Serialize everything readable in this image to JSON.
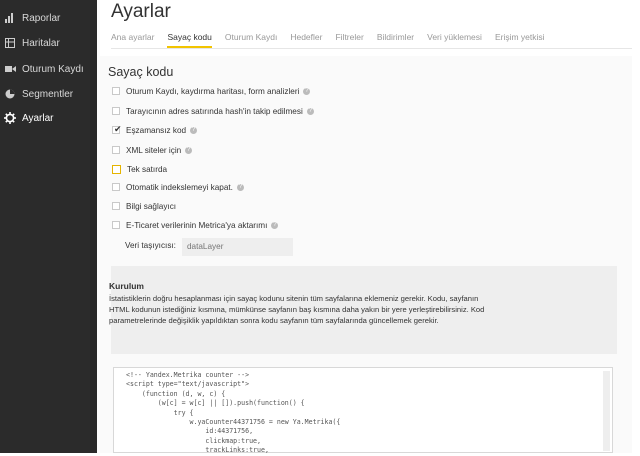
{
  "sidebar": {
    "items": [
      {
        "label": "Raporlar",
        "icon": "bar-chart-icon"
      },
      {
        "label": "Haritalar",
        "icon": "map-icon"
      },
      {
        "label": "Oturum Kaydı",
        "icon": "video-icon"
      },
      {
        "label": "Segmentler",
        "icon": "segment-icon"
      },
      {
        "label": "Ayarlar",
        "icon": "gear-icon",
        "active": true
      }
    ]
  },
  "page": {
    "title": "Ayarlar"
  },
  "tabs": [
    {
      "label": "Ana ayarlar"
    },
    {
      "label": "Sayaç kodu",
      "active": true
    },
    {
      "label": "Oturum Kaydı"
    },
    {
      "label": "Hedefler"
    },
    {
      "label": "Filtreler"
    },
    {
      "label": "Bildirimler"
    },
    {
      "label": "Veri yüklemesi"
    },
    {
      "label": "Erişim yetkisi"
    }
  ],
  "section": {
    "title": "Sayaç kodu"
  },
  "options": [
    {
      "label": "Oturum Kaydı, kaydırma haritası, form analizleri",
      "checked": false,
      "help": true
    },
    {
      "label": "Tarayıcının adres satırında hash'in takip edilmesi",
      "checked": false,
      "help": true
    },
    {
      "label": "Eşzamansız kod",
      "checked": true,
      "help": true
    },
    {
      "label": "XML siteler için",
      "checked": false,
      "help": true
    },
    {
      "label": "Tek satırda",
      "checked": false,
      "help": false,
      "highlight": true
    },
    {
      "label": "Otomatik indekslemeyi kapat.",
      "checked": false,
      "help": true
    },
    {
      "label": "Bilgi sağlayıcı",
      "checked": false,
      "help": false
    },
    {
      "label": "E-Ticaret verilerinin Metrica'ya aktarımı",
      "checked": false,
      "help": true
    }
  ],
  "container": {
    "label": "Veri taşıyıcısı:",
    "placeholder": "dataLayer"
  },
  "kurulum": {
    "title": "Kurulum",
    "text": "İstatistiklerin doğru hesaplanması için sayaç kodunu sitenin tüm sayfalarına eklemeniz gerekir. Kodu, sayfanın HTML kodunun istediğiniz kısmına, mümkünse sayfanın baş kısmına daha yakın bir yere yerleştirebilirsiniz. Kod parametrelerinde değişiklik yapıldıktan sonra kodu sayfanın tüm sayfalarında güncellemek gerekir."
  },
  "code": "<!-- Yandex.Metrika counter -->\n<script type=\"text/javascript\">\n    (function (d, w, c) {\n        (w[c] = w[c] || []).push(function() {\n            try {\n                w.yaCounter44371756 = new Ya.Metrika({\n                    id:44371756,\n                    clickmap:true,\n                    trackLinks:true,"
}
